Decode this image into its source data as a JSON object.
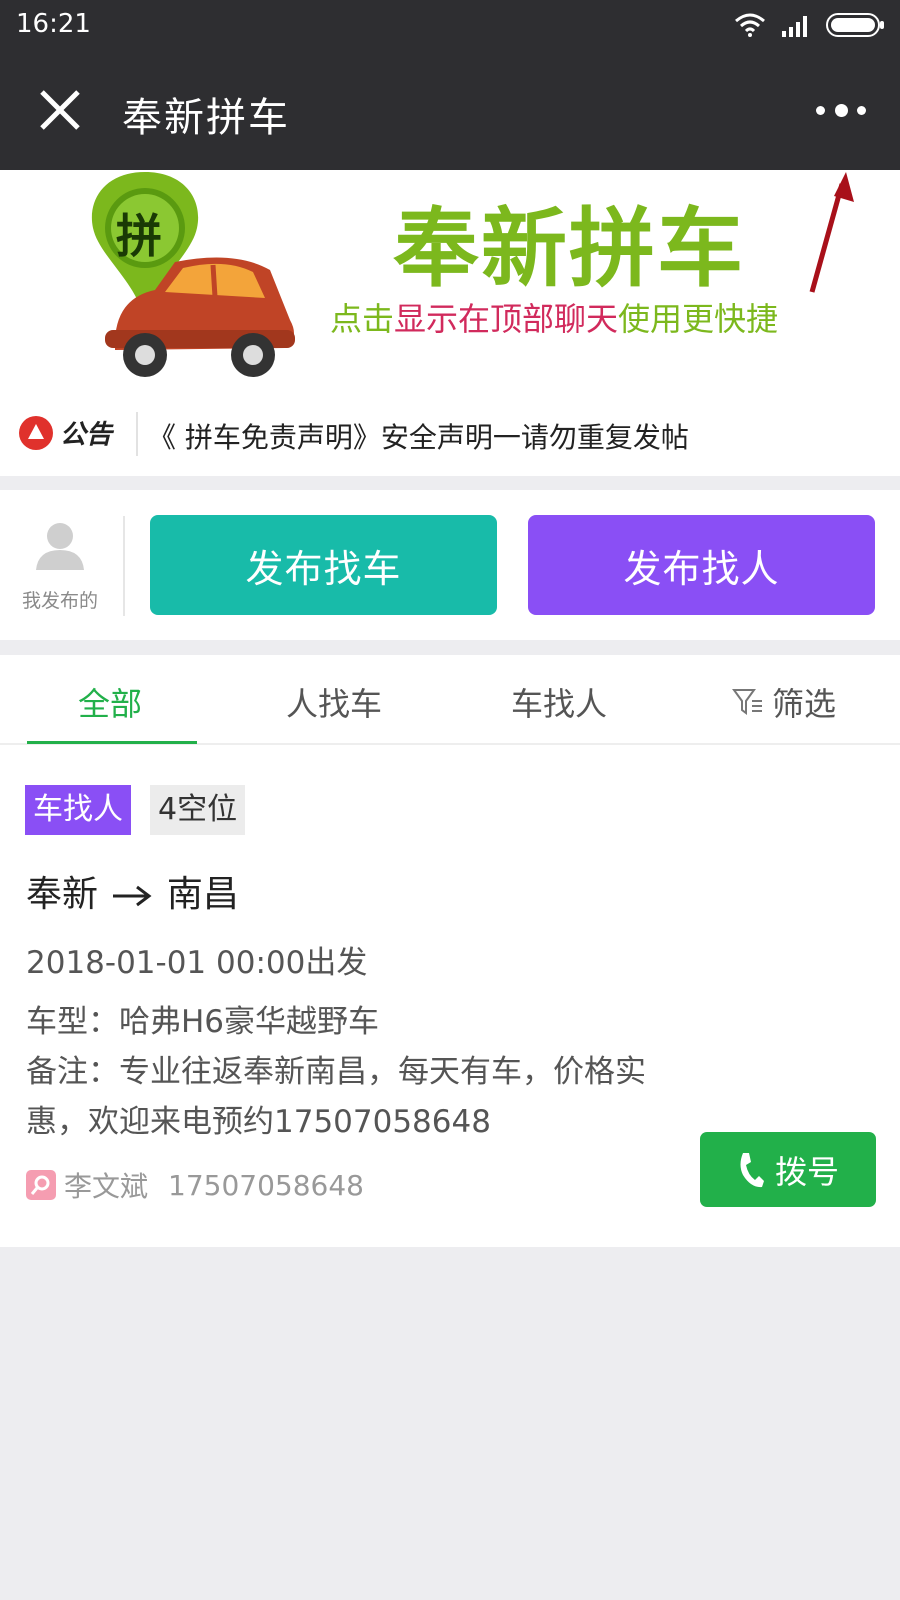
{
  "status_bar": {
    "time": "16:21"
  },
  "nav": {
    "title": "奉新拼车"
  },
  "banner": {
    "badge_char": "拼",
    "headline": "奉新拼车",
    "sub_part1": "点击",
    "sub_part2": "显示在顶部聊天",
    "sub_part3": "使用更快捷"
  },
  "notice": {
    "logo_text": "公告",
    "text": "《 拼车免责声明》安全声明一请勿重复发帖"
  },
  "actions": {
    "my_posts": "我发布的",
    "find_car": "发布找车",
    "find_people": "发布找人"
  },
  "tabs": [
    {
      "label": "全部"
    },
    {
      "label": "人找车"
    },
    {
      "label": "车找人"
    },
    {
      "label": "筛选"
    }
  ],
  "listing": {
    "type_tag": "车找人",
    "seats_tag": "4空位",
    "from": "奉新",
    "to": "南昌",
    "depart": "2018-01-01 00:00出发",
    "vehicle": "车型：哈弗H6豪华越野车",
    "note": "备注：专业往返奉新南昌，每天有车，价格实惠，欢迎来电预约17507058648",
    "contact_name": "李文斌",
    "contact_phone": "17507058648",
    "dial_label": "拨号"
  },
  "colors": {
    "accent_green": "#22b04a",
    "teal": "#18bba9",
    "purple": "#8a4ff5",
    "banner_green": "#7cb81d"
  }
}
